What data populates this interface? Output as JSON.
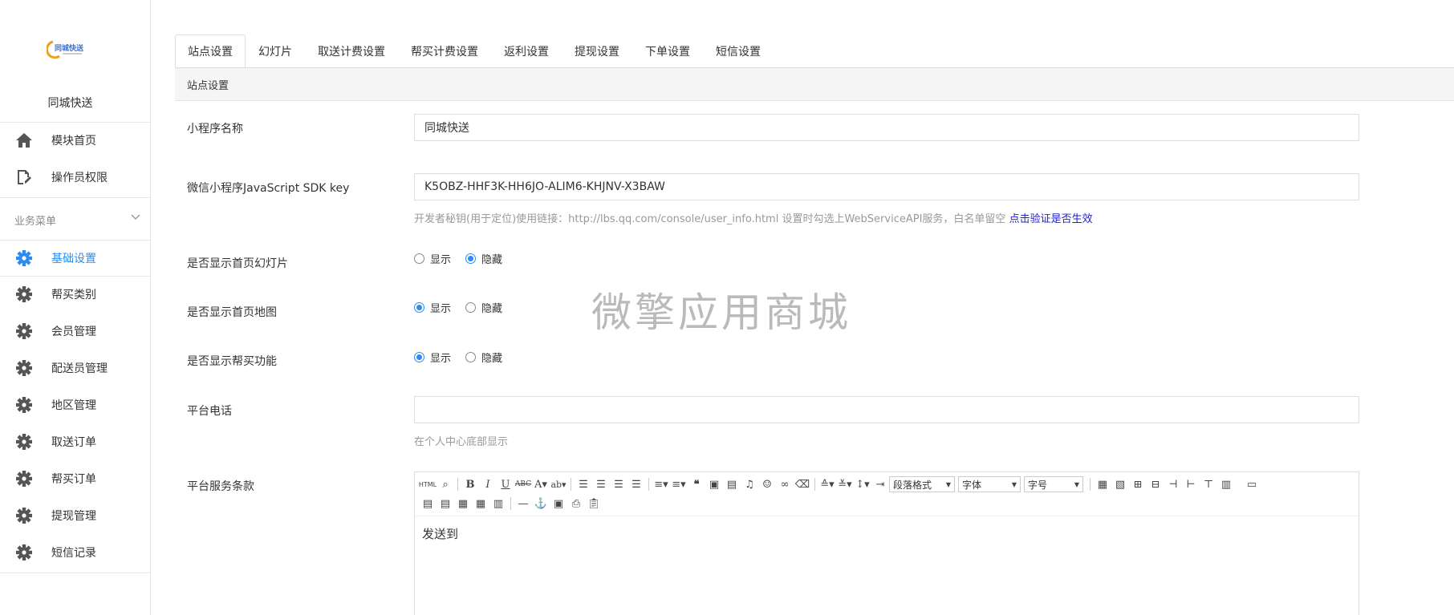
{
  "sidebar": {
    "site_name": "同城快送",
    "top_items": [
      {
        "label": "模块首页",
        "icon": "home-icon"
      },
      {
        "label": "操作员权限",
        "icon": "edit-doc-icon"
      }
    ],
    "group_label": "业务菜单",
    "items": [
      {
        "label": "基础设置",
        "icon": "gear-icon",
        "active": true
      },
      {
        "label": "帮买类别",
        "icon": "gear-icon"
      },
      {
        "label": "会员管理",
        "icon": "gear-icon"
      },
      {
        "label": "配送员管理",
        "icon": "gear-icon"
      },
      {
        "label": "地区管理",
        "icon": "gear-icon"
      },
      {
        "label": "取送订单",
        "icon": "gear-icon"
      },
      {
        "label": "帮买订单",
        "icon": "gear-icon"
      },
      {
        "label": "提现管理",
        "icon": "gear-icon"
      },
      {
        "label": "短信记录",
        "icon": "gear-icon"
      }
    ]
  },
  "tabs": [
    "站点设置",
    "幻灯片",
    "取送计费设置",
    "帮买计费设置",
    "返利设置",
    "提现设置",
    "下单设置",
    "短信设置"
  ],
  "panel_title": "站点设置",
  "form": {
    "app_name": {
      "label": "小程序名称",
      "value": "同城快送"
    },
    "sdk_key": {
      "label": "微信小程序JavaScript SDK key",
      "value": "K5OBZ-HHF3K-HH6JO-ALIM6-KHJNV-X3BAW",
      "help": "开发者秘钥(用于定位)使用链接：http://lbs.qq.com/console/user_info.html 设置时勾选上WebServiceAPI服务，白名单留空",
      "help_link": "点击验证是否生效"
    },
    "show_slides": {
      "label": "是否显示首页幻灯片",
      "options": [
        "显示",
        "隐藏"
      ],
      "selected": 1
    },
    "show_map": {
      "label": "是否显示首页地图",
      "options": [
        "显示",
        "隐藏"
      ],
      "selected": 0
    },
    "show_buy": {
      "label": "是否显示帮买功能",
      "options": [
        "显示",
        "隐藏"
      ],
      "selected": 0
    },
    "phone": {
      "label": "平台电话",
      "value": "",
      "help": "在个人中心底部显示"
    },
    "terms": {
      "label": "平台服务条款",
      "content": "发送到"
    }
  },
  "editor": {
    "paragraph_select": "段落格式",
    "font_select": "字体",
    "size_select": "字号"
  },
  "watermark": "微擎应用商城",
  "colors": {
    "accent": "#2d8cf0",
    "link": "#2222cc"
  }
}
